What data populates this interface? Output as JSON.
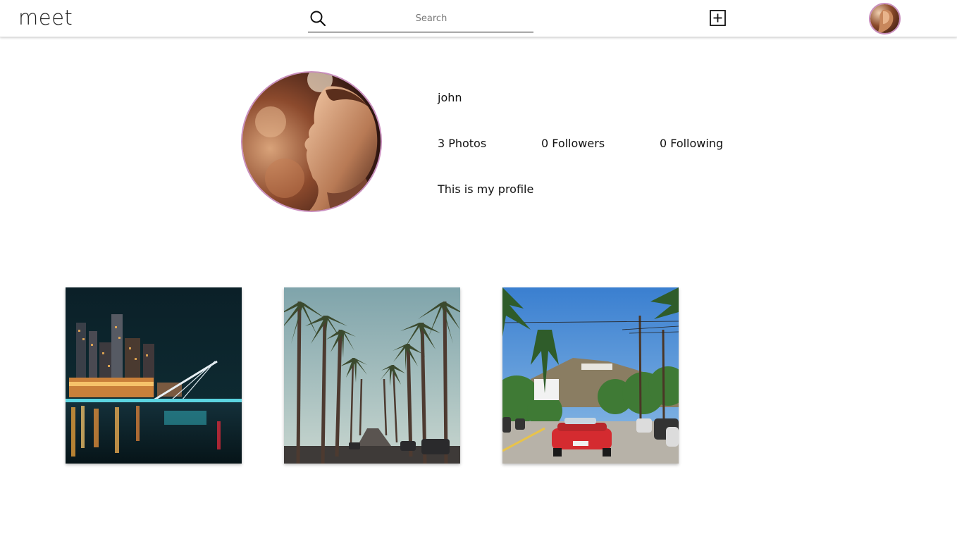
{
  "app": {
    "logo": "meet"
  },
  "search": {
    "placeholder": "Search",
    "icon": "search-icon"
  },
  "header": {
    "add_icon": "plus-square-icon",
    "avatar": "profile-avatar"
  },
  "profile": {
    "username": "john",
    "stats": {
      "photos": {
        "count": "3",
        "label": "Photos"
      },
      "followers": {
        "count": "0",
        "label": "Followers"
      },
      "following": {
        "count": "0",
        "label": "Following"
      }
    },
    "bio": "This is my profile"
  },
  "photos": [
    {
      "subject": "city skyline with bridge at night"
    },
    {
      "subject": "palm tree lined street"
    },
    {
      "subject": "street with red convertible"
    }
  ],
  "colors": {
    "avatar_ring": "#c98fbe",
    "text": "#111111",
    "header_border": "#d8d8d8"
  }
}
